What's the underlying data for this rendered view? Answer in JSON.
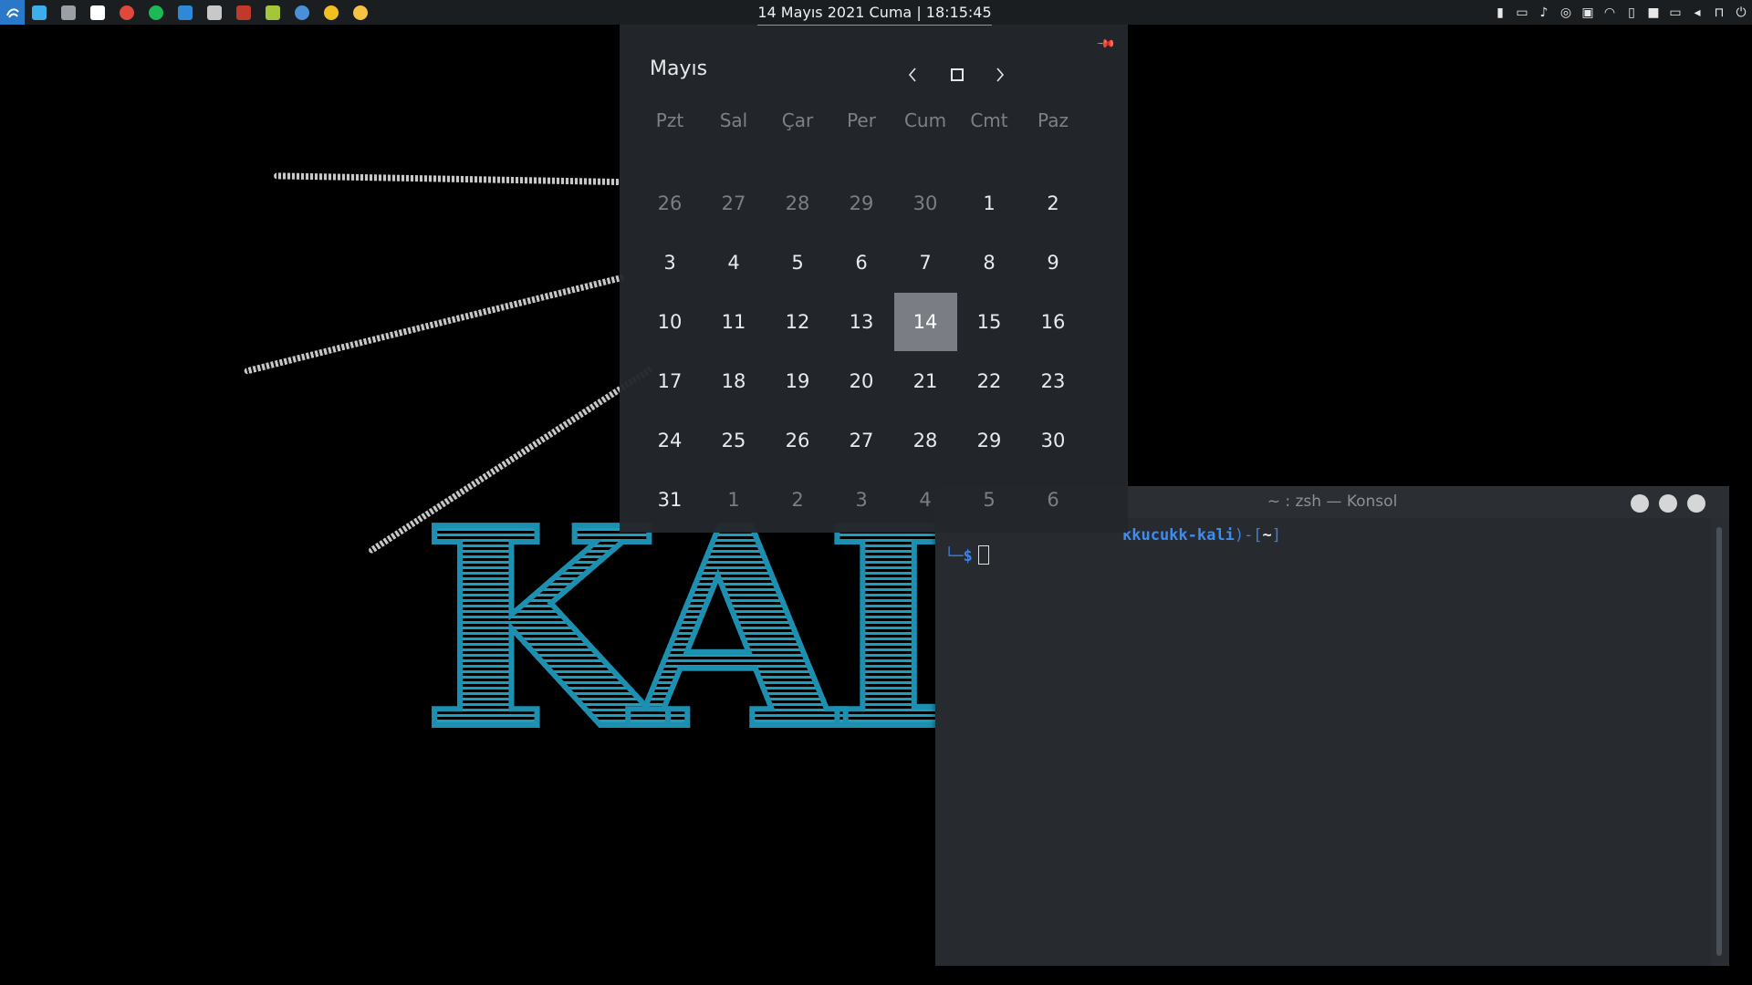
{
  "panel": {
    "clock_text": "14 Mayıs 2021 Cuma | 18:15:45",
    "launchers": [
      {
        "name": "kde-connect-icon",
        "color": "#3daee9"
      },
      {
        "name": "window-icon",
        "color": "#9aa0a6"
      },
      {
        "name": "folder-icon",
        "color": "#ffffff"
      },
      {
        "name": "chrome-icon",
        "color": "#e0483b"
      },
      {
        "name": "spotify-icon",
        "color": "#1db954"
      },
      {
        "name": "vscode-icon",
        "color": "#2f89d8"
      },
      {
        "name": "terminal-icon",
        "color": "#c8c8c8"
      },
      {
        "name": "app-icon",
        "color": "#c0392b"
      },
      {
        "name": "android-icon",
        "color": "#a4c639"
      },
      {
        "name": "browser-icon",
        "color": "#4a90d9"
      },
      {
        "name": "gnome-icon",
        "color": "#f0c020"
      },
      {
        "name": "emoji-icon",
        "color": "#f5c242"
      }
    ],
    "tray_icons": [
      "clipboard-icon",
      "display-icon",
      "notifications-icon",
      "status-icon",
      "kdeconnect-tray-icon",
      "wifi-icon",
      "battery-icon",
      "white-box-icon",
      "network-icon",
      "volume-icon",
      "lock-icon",
      "power-icon"
    ]
  },
  "calendar": {
    "month": "Mayıs",
    "weekdays": [
      "Pzt",
      "Sal",
      "Çar",
      "Per",
      "Cum",
      "Cmt",
      "Paz"
    ],
    "weeks": [
      [
        {
          "d": "26",
          "o": true
        },
        {
          "d": "27",
          "o": true
        },
        {
          "d": "28",
          "o": true
        },
        {
          "d": "29",
          "o": true
        },
        {
          "d": "30",
          "o": true
        },
        {
          "d": "1"
        },
        {
          "d": "2"
        }
      ],
      [
        {
          "d": "3"
        },
        {
          "d": "4"
        },
        {
          "d": "5"
        },
        {
          "d": "6"
        },
        {
          "d": "7"
        },
        {
          "d": "8"
        },
        {
          "d": "9"
        }
      ],
      [
        {
          "d": "10"
        },
        {
          "d": "11"
        },
        {
          "d": "12"
        },
        {
          "d": "13"
        },
        {
          "d": "14",
          "today": true
        },
        {
          "d": "15"
        },
        {
          "d": "16"
        }
      ],
      [
        {
          "d": "17"
        },
        {
          "d": "18"
        },
        {
          "d": "19"
        },
        {
          "d": "20"
        },
        {
          "d": "21"
        },
        {
          "d": "22"
        },
        {
          "d": "23"
        }
      ],
      [
        {
          "d": "24"
        },
        {
          "d": "25"
        },
        {
          "d": "26"
        },
        {
          "d": "27"
        },
        {
          "d": "28"
        },
        {
          "d": "29"
        },
        {
          "d": "30"
        }
      ],
      [
        {
          "d": "31"
        },
        {
          "d": "1",
          "o": true
        },
        {
          "d": "2",
          "o": true
        },
        {
          "d": "3",
          "o": true
        },
        {
          "d": "4",
          "o": true
        },
        {
          "d": "5",
          "o": true
        },
        {
          "d": "6",
          "o": true
        }
      ]
    ]
  },
  "konsole": {
    "title": "~ : zsh — Konsol",
    "prompt_host": "kkucukk-kali",
    "prompt_close": ")-[",
    "prompt_dir": "~",
    "prompt_end": "]",
    "prompt_corner": "└─",
    "prompt_symbol": "$"
  },
  "wallpaper": {
    "logo_text": "KALI",
    "accent_color": "#1e9dbd"
  }
}
